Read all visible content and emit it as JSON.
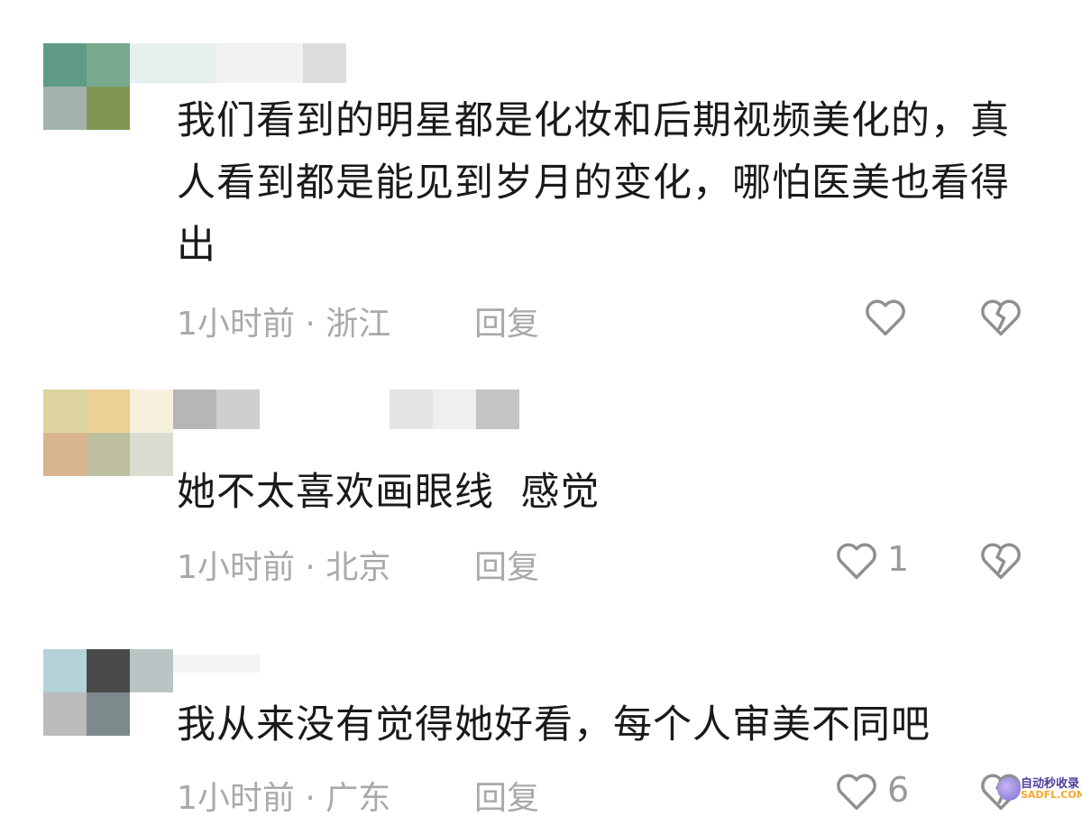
{
  "comments": [
    {
      "text": "我们看到的明星都是化妆和后期视频美化的，真人看到都是能见到岁月的变化，哪怕医美也看得出",
      "time_location": "1小时前 · 浙江",
      "reply_label": "回复",
      "like_count": "",
      "like_icon": "heart-outline-icon",
      "dislike_icon": "broken-heart-icon"
    },
    {
      "text": "她不太喜欢画眼线  感觉",
      "time_location": "1小时前 · 北京",
      "reply_label": "回复",
      "like_count": "1",
      "like_icon": "heart-outline-icon",
      "dislike_icon": "broken-heart-icon"
    },
    {
      "text": "我从来没有觉得她好看，每个人审美不同吧",
      "time_location": "1小时前 · 广东",
      "reply_label": "回复",
      "like_count": "6",
      "like_icon": "heart-outline-icon",
      "dislike_icon": "broken-heart-icon"
    }
  ],
  "watermark": {
    "line1": "自动秒收录",
    "line2": "SADFL.COM"
  },
  "colors": {
    "text": "#1a1a1a",
    "meta": "#a9a9a9",
    "icon": "#8f8f8f"
  }
}
